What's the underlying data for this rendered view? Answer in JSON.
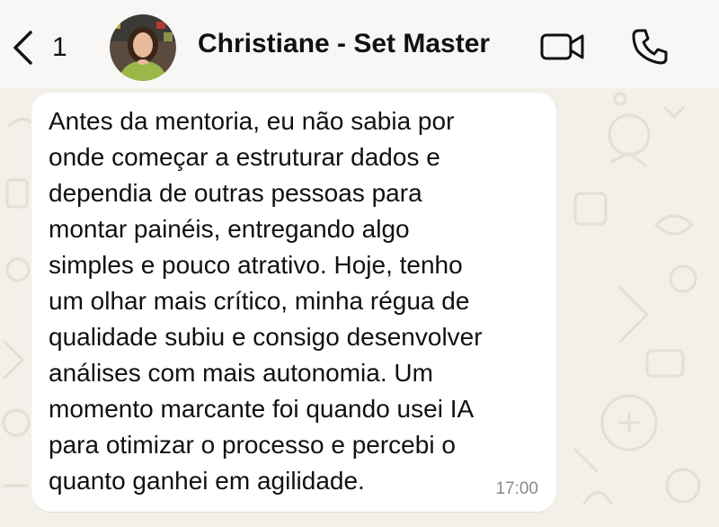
{
  "header": {
    "back_label": "",
    "unread_count": "1",
    "contact_name": "Christiane - Set Master",
    "video_icon": "video-camera-icon",
    "call_icon": "phone-icon"
  },
  "colors": {
    "header_bg": "#f8f7f5",
    "chat_bg": "#f3efe9",
    "bubble_bg": "#ffffff",
    "text": "#111111",
    "timestamp": "#8a8a8a"
  },
  "message": {
    "lines": [
      "Antes da mentoria, eu não sabia por",
      "onde começar a estruturar dados e",
      "dependia de outras pessoas para",
      "montar painéis, entregando algo",
      "simples e pouco atrativo. Hoje, tenho",
      "um olhar mais crítico, minha régua de",
      "qualidade subiu e consigo desenvolver",
      "análises com mais autonomia. Um",
      "momento marcante foi quando usei IA",
      "para otimizar o processo e percebi o",
      "quanto ganhei em agilidade."
    ],
    "time": "17:00"
  }
}
